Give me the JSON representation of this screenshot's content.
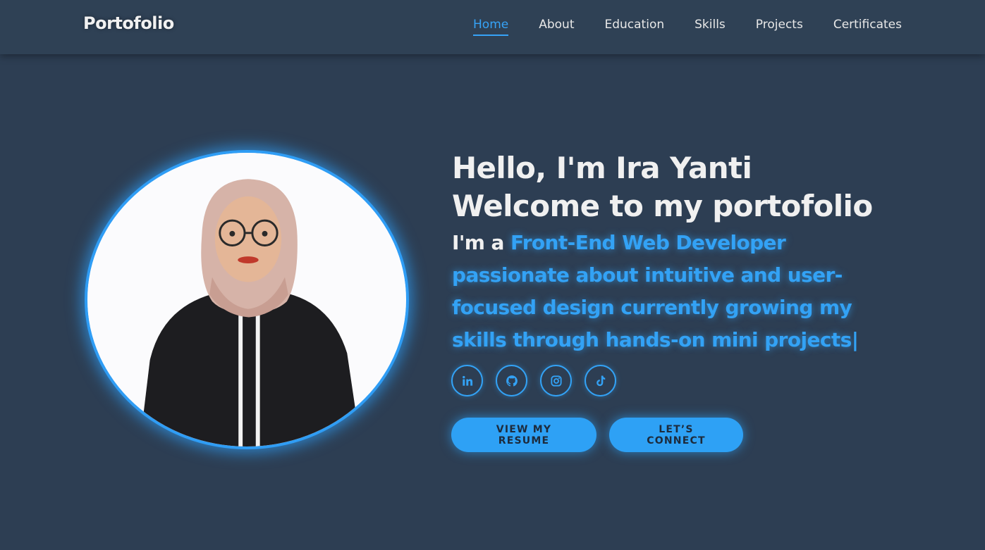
{
  "nav": {
    "logo": "Portofolio",
    "links": [
      "Home",
      "About",
      "Education",
      "Skills",
      "Projects",
      "Certificates"
    ],
    "active": "Home"
  },
  "hero": {
    "greeting": "Hello, I'm Ira Yanti",
    "welcome": "Welcome to my portofolio",
    "tagline_prefix": "I'm a",
    "tagline_typed": "Front-End Web Developer passionate about intuitive and user-focused design currently growing my skills through hands-on mini projects",
    "cursor": "|"
  },
  "socials": [
    "linkedin-icon",
    "github-icon",
    "instagram-icon",
    "tiktok-icon"
  ],
  "buttons": {
    "resume": "VIEW MY RESUME",
    "connect": "LET’S CONNECT"
  },
  "colors": {
    "background": "#2d3e53",
    "navbar": "#2f4155",
    "accent": "#33a2f5",
    "text": "#f0f0f0"
  }
}
